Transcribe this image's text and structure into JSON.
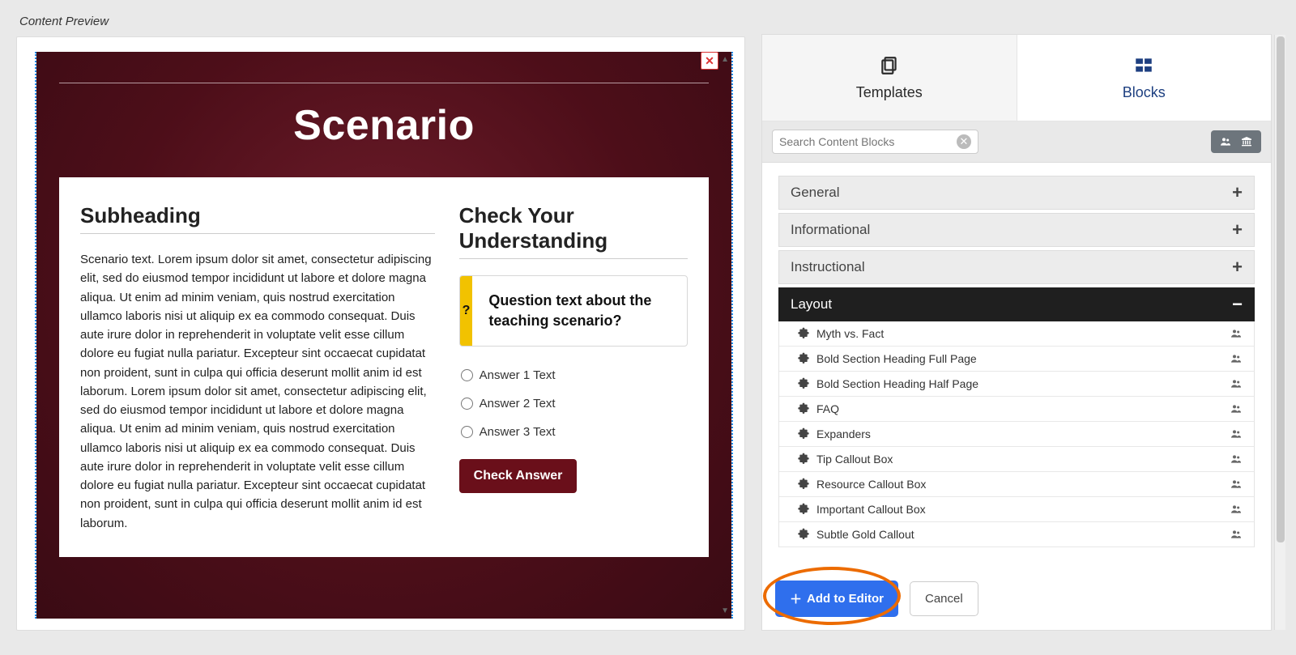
{
  "preview": {
    "section_label": "Content Preview",
    "scenario_title": "Scenario",
    "subheading": "Subheading",
    "body_text": "Scenario text.  Lorem ipsum dolor sit amet, consectetur adipiscing elit, sed do eiusmod tempor incididunt ut labore et dolore magna aliqua. Ut enim ad minim veniam, quis nostrud exercitation ullamco laboris nisi ut aliquip ex ea commodo consequat. Duis aute irure dolor in reprehenderit in voluptate velit esse cillum dolore eu fugiat nulla pariatur. Excepteur sint occaecat cupidatat non proident, sunt in culpa qui officia deserunt mollit anim id est laborum.  Lorem ipsum dolor sit amet, consectetur adipiscing elit, sed do eiusmod tempor incididunt ut labore et dolore magna aliqua. Ut enim ad minim veniam, quis nostrud exercitation ullamco laboris nisi ut aliquip ex ea commodo consequat. Duis aute irure dolor in reprehenderit in voluptate velit esse cillum dolore eu fugiat nulla pariatur. Excepteur sint occaecat cupidatat non proident, sunt in culpa qui officia deserunt mollit anim id est laborum.",
    "check_heading": "Check Your Understanding",
    "question_text": "Question text about the teaching scenario?",
    "answers": [
      "Answer 1 Text",
      "Answer 2 Text",
      "Answer 3 Text"
    ],
    "check_button": "Check Answer",
    "qmark": "?"
  },
  "sidebar": {
    "tabs": {
      "templates": "Templates",
      "blocks": "Blocks"
    },
    "search_placeholder": "Search Content Blocks",
    "accordions": {
      "general": "General",
      "informational": "Informational",
      "instructional": "Instructional",
      "layout": "Layout"
    },
    "layout_items": [
      "Myth vs. Fact",
      "Bold Section Heading Full Page",
      "Bold Section Heading Half Page",
      "FAQ",
      "Expanders",
      "Tip Callout Box",
      "Resource Callout Box",
      "Important Callout Box",
      "Subtle Gold Callout"
    ],
    "add_button": "Add to Editor",
    "cancel_button": "Cancel"
  }
}
